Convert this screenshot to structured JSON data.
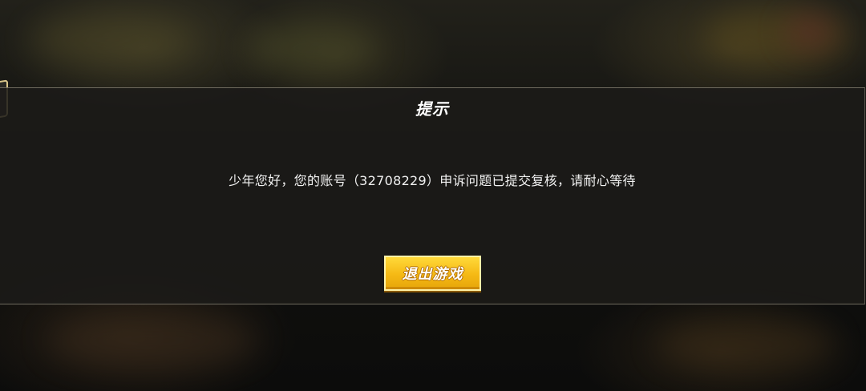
{
  "dialog": {
    "title": "提示",
    "message": "少年您好，您的账号（32708229）申诉问题已提交复核，请耐心等待",
    "exit_button_label": "退出游戏"
  },
  "colors": {
    "button_fill": "#f5b914",
    "button_border": "#fff2a8",
    "dialog_border": "#6e6a5e",
    "side_tab_border": "#d9c58a"
  }
}
